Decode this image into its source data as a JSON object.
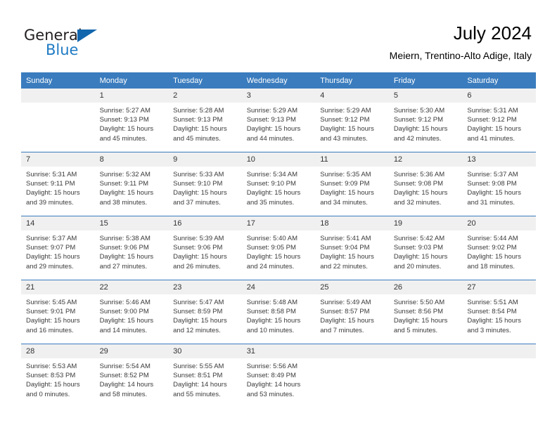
{
  "brand": {
    "word1": "General",
    "word2": "Blue",
    "triangle_color": "#1266ad",
    "word2_color": "#1f7bc4"
  },
  "header": {
    "title": "July 2024",
    "subtitle": "Meiern, Trentino-Alto Adige, Italy",
    "header_bg": "#3a7cbe",
    "daynum_bg": "#f0f0f0"
  },
  "weekday_headers": [
    "Sunday",
    "Monday",
    "Tuesday",
    "Wednesday",
    "Thursday",
    "Friday",
    "Saturday"
  ],
  "weeks": [
    [
      {
        "day": "",
        "sunrise": "",
        "sunset": "",
        "daylight1": "",
        "daylight2": ""
      },
      {
        "day": "1",
        "sunrise": "Sunrise: 5:27 AM",
        "sunset": "Sunset: 9:13 PM",
        "daylight1": "Daylight: 15 hours",
        "daylight2": "and 45 minutes."
      },
      {
        "day": "2",
        "sunrise": "Sunrise: 5:28 AM",
        "sunset": "Sunset: 9:13 PM",
        "daylight1": "Daylight: 15 hours",
        "daylight2": "and 45 minutes."
      },
      {
        "day": "3",
        "sunrise": "Sunrise: 5:29 AM",
        "sunset": "Sunset: 9:13 PM",
        "daylight1": "Daylight: 15 hours",
        "daylight2": "and 44 minutes."
      },
      {
        "day": "4",
        "sunrise": "Sunrise: 5:29 AM",
        "sunset": "Sunset: 9:12 PM",
        "daylight1": "Daylight: 15 hours",
        "daylight2": "and 43 minutes."
      },
      {
        "day": "5",
        "sunrise": "Sunrise: 5:30 AM",
        "sunset": "Sunset: 9:12 PM",
        "daylight1": "Daylight: 15 hours",
        "daylight2": "and 42 minutes."
      },
      {
        "day": "6",
        "sunrise": "Sunrise: 5:31 AM",
        "sunset": "Sunset: 9:12 PM",
        "daylight1": "Daylight: 15 hours",
        "daylight2": "and 41 minutes."
      }
    ],
    [
      {
        "day": "7",
        "sunrise": "Sunrise: 5:31 AM",
        "sunset": "Sunset: 9:11 PM",
        "daylight1": "Daylight: 15 hours",
        "daylight2": "and 39 minutes."
      },
      {
        "day": "8",
        "sunrise": "Sunrise: 5:32 AM",
        "sunset": "Sunset: 9:11 PM",
        "daylight1": "Daylight: 15 hours",
        "daylight2": "and 38 minutes."
      },
      {
        "day": "9",
        "sunrise": "Sunrise: 5:33 AM",
        "sunset": "Sunset: 9:10 PM",
        "daylight1": "Daylight: 15 hours",
        "daylight2": "and 37 minutes."
      },
      {
        "day": "10",
        "sunrise": "Sunrise: 5:34 AM",
        "sunset": "Sunset: 9:10 PM",
        "daylight1": "Daylight: 15 hours",
        "daylight2": "and 35 minutes."
      },
      {
        "day": "11",
        "sunrise": "Sunrise: 5:35 AM",
        "sunset": "Sunset: 9:09 PM",
        "daylight1": "Daylight: 15 hours",
        "daylight2": "and 34 minutes."
      },
      {
        "day": "12",
        "sunrise": "Sunrise: 5:36 AM",
        "sunset": "Sunset: 9:08 PM",
        "daylight1": "Daylight: 15 hours",
        "daylight2": "and 32 minutes."
      },
      {
        "day": "13",
        "sunrise": "Sunrise: 5:37 AM",
        "sunset": "Sunset: 9:08 PM",
        "daylight1": "Daylight: 15 hours",
        "daylight2": "and 31 minutes."
      }
    ],
    [
      {
        "day": "14",
        "sunrise": "Sunrise: 5:37 AM",
        "sunset": "Sunset: 9:07 PM",
        "daylight1": "Daylight: 15 hours",
        "daylight2": "and 29 minutes."
      },
      {
        "day": "15",
        "sunrise": "Sunrise: 5:38 AM",
        "sunset": "Sunset: 9:06 PM",
        "daylight1": "Daylight: 15 hours",
        "daylight2": "and 27 minutes."
      },
      {
        "day": "16",
        "sunrise": "Sunrise: 5:39 AM",
        "sunset": "Sunset: 9:06 PM",
        "daylight1": "Daylight: 15 hours",
        "daylight2": "and 26 minutes."
      },
      {
        "day": "17",
        "sunrise": "Sunrise: 5:40 AM",
        "sunset": "Sunset: 9:05 PM",
        "daylight1": "Daylight: 15 hours",
        "daylight2": "and 24 minutes."
      },
      {
        "day": "18",
        "sunrise": "Sunrise: 5:41 AM",
        "sunset": "Sunset: 9:04 PM",
        "daylight1": "Daylight: 15 hours",
        "daylight2": "and 22 minutes."
      },
      {
        "day": "19",
        "sunrise": "Sunrise: 5:42 AM",
        "sunset": "Sunset: 9:03 PM",
        "daylight1": "Daylight: 15 hours",
        "daylight2": "and 20 minutes."
      },
      {
        "day": "20",
        "sunrise": "Sunrise: 5:44 AM",
        "sunset": "Sunset: 9:02 PM",
        "daylight1": "Daylight: 15 hours",
        "daylight2": "and 18 minutes."
      }
    ],
    [
      {
        "day": "21",
        "sunrise": "Sunrise: 5:45 AM",
        "sunset": "Sunset: 9:01 PM",
        "daylight1": "Daylight: 15 hours",
        "daylight2": "and 16 minutes."
      },
      {
        "day": "22",
        "sunrise": "Sunrise: 5:46 AM",
        "sunset": "Sunset: 9:00 PM",
        "daylight1": "Daylight: 15 hours",
        "daylight2": "and 14 minutes."
      },
      {
        "day": "23",
        "sunrise": "Sunrise: 5:47 AM",
        "sunset": "Sunset: 8:59 PM",
        "daylight1": "Daylight: 15 hours",
        "daylight2": "and 12 minutes."
      },
      {
        "day": "24",
        "sunrise": "Sunrise: 5:48 AM",
        "sunset": "Sunset: 8:58 PM",
        "daylight1": "Daylight: 15 hours",
        "daylight2": "and 10 minutes."
      },
      {
        "day": "25",
        "sunrise": "Sunrise: 5:49 AM",
        "sunset": "Sunset: 8:57 PM",
        "daylight1": "Daylight: 15 hours",
        "daylight2": "and 7 minutes."
      },
      {
        "day": "26",
        "sunrise": "Sunrise: 5:50 AM",
        "sunset": "Sunset: 8:56 PM",
        "daylight1": "Daylight: 15 hours",
        "daylight2": "and 5 minutes."
      },
      {
        "day": "27",
        "sunrise": "Sunrise: 5:51 AM",
        "sunset": "Sunset: 8:54 PM",
        "daylight1": "Daylight: 15 hours",
        "daylight2": "and 3 minutes."
      }
    ],
    [
      {
        "day": "28",
        "sunrise": "Sunrise: 5:53 AM",
        "sunset": "Sunset: 8:53 PM",
        "daylight1": "Daylight: 15 hours",
        "daylight2": "and 0 minutes."
      },
      {
        "day": "29",
        "sunrise": "Sunrise: 5:54 AM",
        "sunset": "Sunset: 8:52 PM",
        "daylight1": "Daylight: 14 hours",
        "daylight2": "and 58 minutes."
      },
      {
        "day": "30",
        "sunrise": "Sunrise: 5:55 AM",
        "sunset": "Sunset: 8:51 PM",
        "daylight1": "Daylight: 14 hours",
        "daylight2": "and 55 minutes."
      },
      {
        "day": "31",
        "sunrise": "Sunrise: 5:56 AM",
        "sunset": "Sunset: 8:49 PM",
        "daylight1": "Daylight: 14 hours",
        "daylight2": "and 53 minutes."
      },
      {
        "day": "",
        "sunrise": "",
        "sunset": "",
        "daylight1": "",
        "daylight2": ""
      },
      {
        "day": "",
        "sunrise": "",
        "sunset": "",
        "daylight1": "",
        "daylight2": ""
      },
      {
        "day": "",
        "sunrise": "",
        "sunset": "",
        "daylight1": "",
        "daylight2": ""
      }
    ]
  ]
}
